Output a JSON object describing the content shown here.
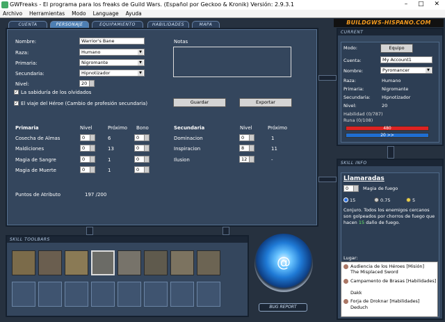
{
  "titlebar": {
    "title": "GWFreaks - El programa para los freaks de Guild Wars. (Español por Geckoo & Kronik) Versión: 2.9.3.1"
  },
  "menu": [
    "Archivo",
    "Herramientas",
    "Modo",
    "Language",
    "Ayuda"
  ],
  "tabs": [
    "CUENTA",
    "PERSONAJE",
    "EQUIPAMIENTO",
    "HABILIDADES",
    "MAPA"
  ],
  "brand": "BUILDGWS-HISPANO.COM",
  "form": {
    "nombre_label": "Nombre:",
    "nombre_value": "Warrior's Bane",
    "raza_label": "Raza:",
    "raza_value": "Humano",
    "primaria_label": "Primaria:",
    "primaria_value": "Nigromante",
    "secundaria_label": "Secundaria:",
    "secundaria_value": "Hipnotizador",
    "nivel_label": "Nivel:",
    "nivel_value": "20",
    "cb1": "La sabiduría de los olvidados",
    "cb2": "El viaje del Héroe (Cambio de profesión secundaria)",
    "notas_label": "Notas",
    "guardar": "Guardar",
    "exportar": "Exportar"
  },
  "attributes": {
    "primaria_header": "Primaria",
    "nivel_header": "Nivel",
    "proximo_header": "Próximo",
    "bono_header": "Bono",
    "primary_rows": [
      {
        "name": "Cosecha de Almas",
        "nivel": "0",
        "proximo": "6",
        "bono": "0"
      },
      {
        "name": "Maldiciones",
        "nivel": "0",
        "proximo": "13",
        "bono": "0"
      },
      {
        "name": "Magia de Sangre",
        "nivel": "0",
        "proximo": "1",
        "bono": "0"
      },
      {
        "name": "Magia de Muerte",
        "nivel": "0",
        "proximo": "1",
        "bono": "0"
      }
    ],
    "secundaria_header": "Secundaria",
    "secondary_rows": [
      {
        "name": "Dominacion",
        "nivel": "0",
        "proximo": "1"
      },
      {
        "name": "Inspiracion",
        "nivel": "8",
        "proximo": "11"
      },
      {
        "name": "Ilusion",
        "nivel": "12",
        "proximo": "-"
      }
    ],
    "puntos_label": "Puntos de Atributo",
    "puntos_value": "197 /200"
  },
  "current": {
    "title": "CURRENT",
    "modo_label": "Modo:",
    "modo_value": "Equipo",
    "cuenta_label": "Cuenta:",
    "cuenta_value": "My Account1",
    "nombre_label": "Nombre:",
    "nombre_value": "Pyromancer",
    "raza_label": "Raza:",
    "raza_value": "Humano",
    "primaria_label": "Primaria:",
    "primaria_value": "Nigromante",
    "secundaria_label": "Secundaria:",
    "secundaria_value": "Hipnotizador",
    "nivel_label": "Nivel:",
    "nivel_value": "20",
    "habilidad": "Habilidad (0/787)",
    "runa": "Runa (0/108)",
    "health": "480",
    "energy": "20 >>"
  },
  "skillinfo": {
    "title": "SKILL INFO",
    "name": "Llamaradas",
    "level": "0",
    "attr": "Magia de fuego",
    "energy": "15",
    "cast": "0.75",
    "recharge": "5",
    "desc1": "Conjuro. Todos los enemigos cercanos",
    "desc2": "son golpeados por chorros de fuego que",
    "desc3": "hacen",
    "desc_dmg": "15",
    "desc4": "daño de fuego.",
    "lugar_label": "Lugar:",
    "lugar": [
      "Audiencia de los Héroes [Misión]",
      "The Misplaced Sword",
      "Campamento de Brasas [Habilidades]",
      "Dakk",
      "Forja de Droknar [Habilidades]",
      "Deduch"
    ]
  },
  "toolbar": {
    "title": "SKILL TOOLBARS",
    "bug": "BUG REPORT"
  }
}
